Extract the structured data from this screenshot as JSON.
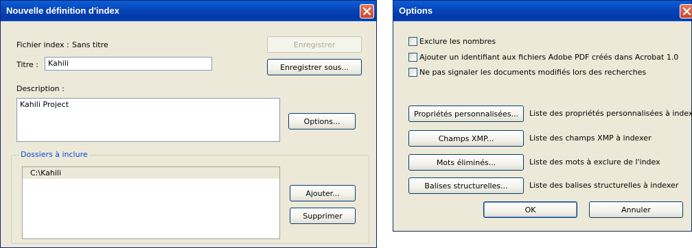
{
  "index_dialog": {
    "title": "Nouvelle définition d'index",
    "file_label": "Fichier index :",
    "file_value": "Sans titre",
    "save_button": "Enregistrer",
    "save_as_button": "Enregistrer sous...",
    "title_label": "Titre :",
    "title_value": "Kahili",
    "description_label": "Description :",
    "description_value": "Kahili Project",
    "options_button": "Options...",
    "folders_group": "Dossiers à inclure",
    "folders": [
      "C:\\Kahili"
    ],
    "add_button": "Ajouter...",
    "remove_button": "Supprimer"
  },
  "options_dialog": {
    "title": "Options",
    "checkboxes": [
      {
        "label": "Exclure les nombres",
        "checked": false
      },
      {
        "label": "Ajouter un identifiant aux fichiers Adobe PDF créés dans Acrobat 1.0",
        "checked": false
      },
      {
        "label": "Ne pas signaler les documents modifiés lors des recherches",
        "checked": false
      }
    ],
    "rows": [
      {
        "button": "Propriétés personnalisées...",
        "desc": "Liste des propriétés personnalisées à indexer"
      },
      {
        "button": "Champs XMP...",
        "desc": "Liste des champs XMP à indexer"
      },
      {
        "button": "Mots éliminés...",
        "desc": "Liste des mots à exclure de l'index"
      },
      {
        "button": "Balises structurelles...",
        "desc": "Liste des balises structurelles à indexer"
      }
    ],
    "ok_button": "OK",
    "cancel_button": "Annuler"
  }
}
